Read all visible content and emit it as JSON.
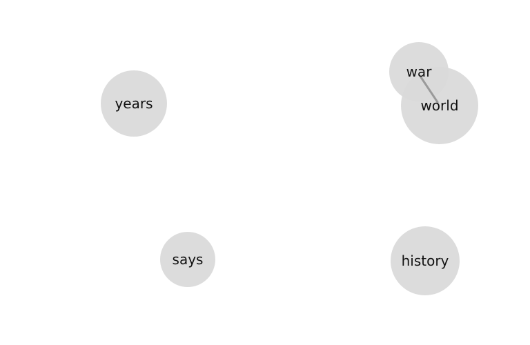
{
  "graph": {
    "nodes": [
      {
        "id": "years",
        "label": "years"
      },
      {
        "id": "says",
        "label": "says"
      },
      {
        "id": "war",
        "label": "war"
      },
      {
        "id": "world",
        "label": "world"
      },
      {
        "id": "history",
        "label": "history"
      }
    ],
    "edges": [
      {
        "source": "war",
        "target": "world"
      }
    ],
    "colors": {
      "node_fill": "#d9d9d9",
      "edge": "#9a9a9a",
      "label": "#111111",
      "background": "#ffffff"
    }
  }
}
